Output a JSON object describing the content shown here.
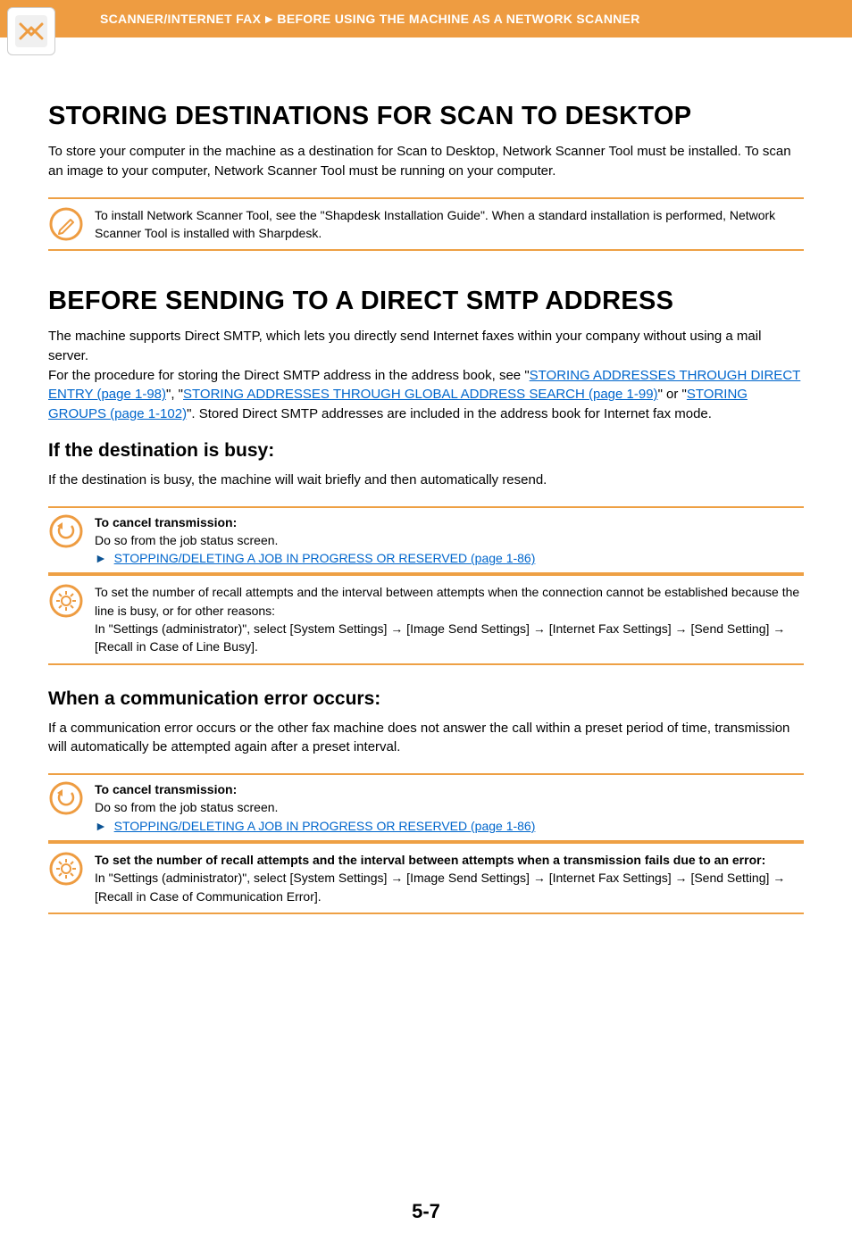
{
  "header": {
    "breadcrumb_left": "SCANNER/INTERNET FAX",
    "breadcrumb_right": "BEFORE USING THE MACHINE AS A NETWORK SCANNER"
  },
  "section1": {
    "title": "STORING DESTINATIONS FOR SCAN TO DESKTOP",
    "body": "To store your computer in the machine as a destination for Scan to Desktop, Network Scanner Tool must be installed. To scan an image to your computer, Network Scanner Tool must be running on your computer.",
    "note": "To install Network Scanner Tool, see the \"Shapdesk Installation Guide\". When a standard installation is performed, Network Scanner Tool is installed with Sharpdesk."
  },
  "section2": {
    "title": "BEFORE SENDING TO A DIRECT SMTP ADDRESS",
    "body_pre": "The machine supports Direct SMTP, which lets you directly send Internet faxes within your company without using a mail server.\nFor the procedure for storing the Direct SMTP address in the address book, see \"",
    "link1": "STORING ADDRESSES THROUGH DIRECT ENTRY (page 1-98)",
    "body_mid1": "\", \"",
    "link2": "STORING ADDRESSES THROUGH GLOBAL ADDRESS SEARCH (page 1-99)",
    "body_mid2": "\" or \"",
    "link3": "STORING GROUPS (page 1-102)",
    "body_post": "\". Stored Direct SMTP addresses are included in the address book for Internet fax mode."
  },
  "busy": {
    "heading": "If the destination is busy:",
    "body": "If the destination is busy, the machine will wait briefly and then automatically resend.",
    "cancel_title": "To cancel transmission:",
    "cancel_body": "Do so from the job status screen.",
    "cancel_link": "STOPPING/DELETING A JOB IN PROGRESS OR RESERVED (page 1-86)",
    "settings_body1": "To set the number of recall attempts and the interval between attempts when the connection cannot be established because the line is busy, or for other reasons:",
    "settings_body2": "In \"Settings (administrator)\", select [System Settings] → [Image Send Settings] → [Internet Fax Settings] → [Send Setting] → [Recall in Case of Line Busy]."
  },
  "error": {
    "heading": "When a communication error occurs:",
    "body": "If a communication error occurs or the other fax machine does not answer the call within a preset period of time, transmission will automatically be attempted again after a preset interval.",
    "cancel_title": "To cancel transmission:",
    "cancel_body": "Do so from the job status screen.",
    "cancel_link": "STOPPING/DELETING A JOB IN PROGRESS OR RESERVED (page 1-86)",
    "settings_title": "To set the number of recall attempts and the interval between attempts when a transmission fails due to an error:",
    "settings_body": "In \"Settings (administrator)\", select [System Settings] → [Image Send Settings] → [Internet Fax Settings] → [Send Setting] → [Recall in Case of Communication Error]."
  },
  "page_number": "5-7",
  "arrow_glyph": "►"
}
